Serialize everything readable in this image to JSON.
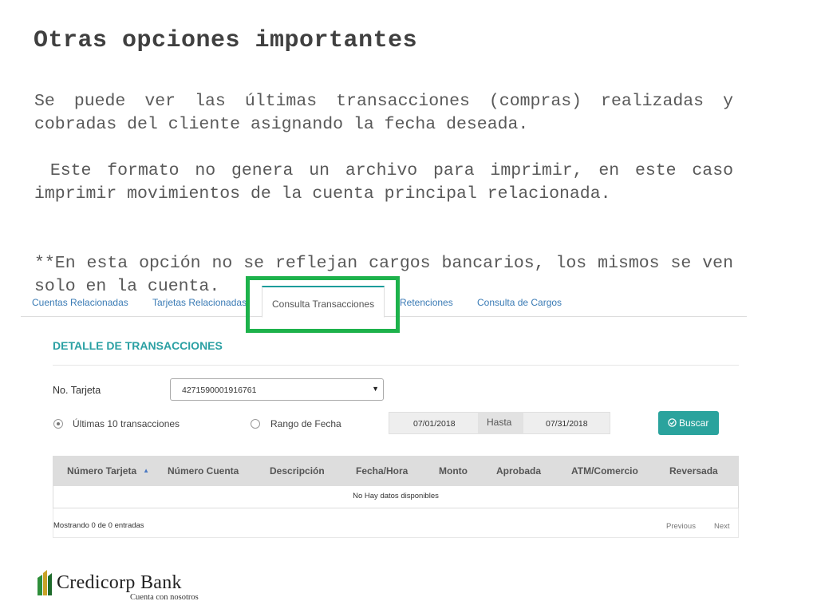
{
  "slide": {
    "title": "Otras opciones importantes",
    "paragraph1": "Se puede ver las últimas transacciones (compras) realizadas y cobradas del cliente asignando la fecha deseada.",
    "paragraph2": " Este formato no genera un archivo para imprimir, en este caso imprimir movimientos de la cuenta principal relacionada.",
    "paragraph3": "**En esta opción no se reflejan cargos bancarios, los mismos se ven solo en la cuenta."
  },
  "tabs": [
    {
      "label": "Cuentas Relacionadas",
      "active": false
    },
    {
      "label": "Tarjetas Relacionadas",
      "active": false
    },
    {
      "label": "Consulta Transacciones",
      "active": true
    },
    {
      "label": "Retenciones",
      "active": false
    },
    {
      "label": "Consulta de Cargos",
      "active": false
    }
  ],
  "panel": {
    "title": "DETALLE DE TRANSACCIONES",
    "tarjeta_label": "No. Tarjeta",
    "tarjeta_value": "4271590001916761",
    "radio_last10": "Últimas 10 transacciones",
    "radio_range": "Rango de Fecha",
    "selected_radio": "last10",
    "date_from": "07/01/2018",
    "date_separator": "Hasta",
    "date_to": "07/31/2018",
    "search_button": "Buscar"
  },
  "table": {
    "columns": [
      "Número Tarjeta",
      "Número Cuenta",
      "Descripción",
      "Fecha/Hora",
      "Monto",
      "Aprobada",
      "ATM/Comercio",
      "Reversada"
    ],
    "empty_message": "No Hay datos disponibles",
    "showing": "Mostrando 0 de 0 entradas",
    "previous": "Previous",
    "next": "Next"
  },
  "logo": {
    "name": "Credicorp Bank",
    "tagline": "Cuenta con nosotros"
  },
  "colors": {
    "accent_teal": "#2aa39d",
    "tab_link": "#3a7bb5",
    "highlight_green": "#1db24b"
  }
}
